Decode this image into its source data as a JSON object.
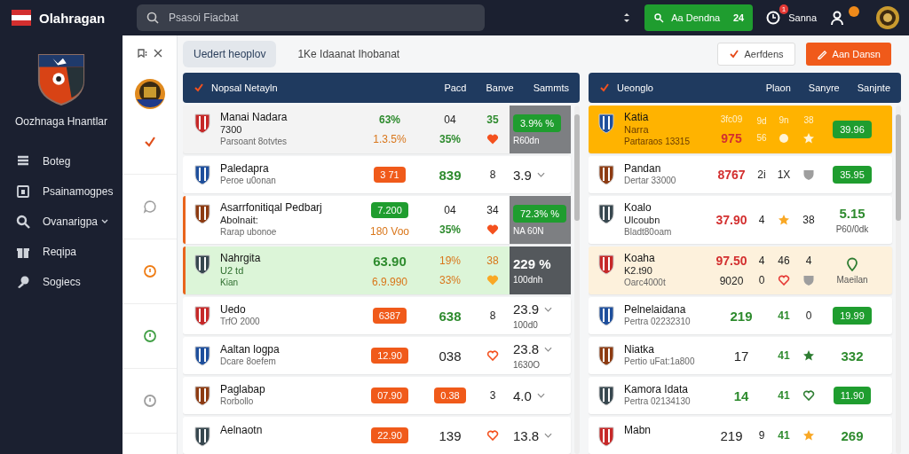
{
  "app": {
    "title": "Olahragan",
    "search_placeholder": "Psasoi Fiacbat",
    "promo_button": {
      "label": "Aa Dendna",
      "count": "24"
    },
    "notifications": "1",
    "user_label": "Sanna"
  },
  "sidebar": {
    "club_name": "Oozhnaga Hnantlar",
    "items": [
      {
        "label": "Boteg",
        "has_caret": false
      },
      {
        "label": "Psainamogpes",
        "has_caret": false
      },
      {
        "label": "Ovanarigpa",
        "has_caret": true
      },
      {
        "label": "Reqipa",
        "has_caret": false
      },
      {
        "label": "Sogiecs",
        "has_caret": false
      }
    ]
  },
  "rail": [
    {
      "kind": "check",
      "color": "#e0501c"
    },
    {
      "kind": "chat",
      "color": "#9e9e9e"
    },
    {
      "kind": "ring",
      "color": "#ef7d16"
    },
    {
      "kind": "ring",
      "color": "#43a047"
    },
    {
      "kind": "ring",
      "color": "#9e9e9e"
    }
  ],
  "toolbar": {
    "tabs": [
      {
        "label": "Uedert heoplov",
        "selected": true
      },
      {
        "label": "1Ke Idaanat Ihobanat",
        "selected": false
      }
    ],
    "buttons": [
      {
        "label": "Aerfdens",
        "kind": "outline"
      },
      {
        "label": "Aan Dansn",
        "kind": "primary"
      }
    ]
  },
  "panels": [
    {
      "title": "Nopsal Netayln",
      "columns": [
        "Pacd",
        "Banve",
        "Sammts"
      ],
      "rows": [
        {
          "name": "Manai Nadara",
          "details": [
            "7300",
            "Parsoant 8otvtes"
          ],
          "kind": "shaded",
          "accent": false,
          "cols": [
            [
              {
                "text": "63%",
                "kind": "text-green"
              },
              {
                "text": "1.3.5%",
                "kind": "text-orange"
              }
            ],
            [
              {
                "text": "04",
                "kind": "text-plain"
              },
              {
                "text": "35%",
                "kind": "text-green"
              }
            ],
            [
              {
                "text": "35",
                "kind": "text-green"
              },
              {
                "kind": "icon-heart",
                "color": "#f4511e"
              }
            ]
          ],
          "odds": {
            "kind": "boxed-pill",
            "main": "3.9% %",
            "sub": "R60dn",
            "expand": false
          }
        },
        {
          "name": "Paledapra",
          "details": [
            "Peroe u0onan"
          ],
          "kind": "plain",
          "accent": false,
          "cols": [
            [
              {
                "text": "3 71",
                "kind": "pill-orange"
              }
            ],
            [
              {
                "text": "839",
                "kind": "text-green-big"
              }
            ],
            [
              {
                "text": "8",
                "kind": "text-plain"
              }
            ]
          ],
          "odds": {
            "kind": "plain",
            "main": "3.9",
            "expand": true
          }
        },
        {
          "name": "Asarrfonitiqal Pedbarj",
          "details": [
            "Abolnait:",
            "Rarap ubonoe"
          ],
          "kind": "plain",
          "accent": true,
          "cols": [
            [
              {
                "text": "7.200",
                "kind": "pill-green"
              },
              {
                "text": "180 Voo",
                "kind": "text-orange"
              }
            ],
            [
              {
                "text": "04",
                "kind": "text-plain"
              },
              {
                "text": "35%",
                "kind": "text-green"
              }
            ],
            [
              {
                "text": "34",
                "kind": "text-plain"
              },
              {
                "kind": "icon-heart",
                "color": "#f4511e"
              }
            ]
          ],
          "odds": {
            "kind": "boxed-pill",
            "main": "72.3% %",
            "sub": "NA 60N",
            "expand": false
          }
        },
        {
          "name": "Nahrgita",
          "details": [
            "U2 td",
            "Kian"
          ],
          "kind": "live",
          "accent": true,
          "cols": [
            [
              {
                "text": "63.90",
                "kind": "text-green-big"
              },
              {
                "text": "6.9.990",
                "kind": "text-orange"
              }
            ],
            [
              {
                "text": "19%",
                "kind": "text-orange"
              },
              {
                "text": "33%",
                "kind": "text-orange"
              }
            ],
            [
              {
                "text": "38",
                "kind": "text-orange"
              },
              {
                "kind": "icon-heart",
                "color": "#f9a825"
              }
            ]
          ],
          "odds": {
            "kind": "dark-box",
            "main": "229 %",
            "sub": "100dnh",
            "expand": false
          }
        },
        {
          "name": "Uedo",
          "details": [
            "TrfO 2000"
          ],
          "kind": "plain",
          "accent": false,
          "cols": [
            [
              {
                "text": "6387",
                "kind": "pill-orange"
              }
            ],
            [
              {
                "text": "638",
                "kind": "text-green-big"
              }
            ],
            [
              {
                "text": "8",
                "kind": "text-plain"
              }
            ]
          ],
          "odds": {
            "kind": "plain",
            "main": "23.9",
            "sub": "100d0",
            "expand": true
          }
        },
        {
          "name": "Aaltan logpa",
          "details": [
            "Dcare 8oefem"
          ],
          "kind": "plain",
          "accent": false,
          "cols": [
            [
              {
                "text": "12.90",
                "kind": "pill-orange"
              }
            ],
            [
              {
                "text": "038",
                "kind": "text-big"
              }
            ],
            [
              {
                "kind": "icon-heart-outline",
                "color": "#f4511e"
              }
            ]
          ],
          "odds": {
            "kind": "plain",
            "main": "23.8",
            "sub": "1630O",
            "expand": true
          }
        },
        {
          "name": "Paglabap",
          "details": [
            "Rorbollo"
          ],
          "kind": "plain",
          "accent": false,
          "cols": [
            [
              {
                "text": "07.90",
                "kind": "pill-orange"
              }
            ],
            [
              {
                "text": "0.38",
                "kind": "pill-orange"
              }
            ],
            [
              {
                "text": "3",
                "kind": "text-plain"
              }
            ]
          ],
          "odds": {
            "kind": "plain",
            "main": "4.0",
            "expand": true
          }
        },
        {
          "name": "Aelnaotn",
          "kind": "plain",
          "accent": false,
          "cols": [
            [
              {
                "text": "22.90",
                "kind": "pill-orange"
              }
            ],
            [
              {
                "text": "139",
                "kind": "text-big"
              }
            ],
            [
              {
                "kind": "icon-heart-outline",
                "color": "#f4511e"
              }
            ]
          ],
          "odds": {
            "kind": "plain",
            "main": "13.8",
            "expand": true
          }
        }
      ]
    },
    {
      "title": "Ueonglo",
      "columns": [
        "Plaon",
        "Sanyre",
        "Sanjnte"
      ],
      "rows": [
        {
          "name": "Katia",
          "details": [
            "Narra",
            "Partaraos 13315"
          ],
          "kind": "featured",
          "accent": false,
          "cols": [
            [
              {
                "text": "3fc09",
                "kind": "text-faint"
              },
              {
                "text": "975",
                "kind": "text-red-big"
              }
            ],
            [
              {
                "text": "9d",
                "kind": "text-faint"
              },
              {
                "text": "56",
                "kind": "text-faint"
              }
            ],
            [
              {
                "text": "9n",
                "kind": "text-faint"
              },
              {
                "kind": "icon-dot",
                "color": "#fff3d6"
              }
            ],
            [
              {
                "text": "38",
                "kind": "text-faint"
              },
              {
                "kind": "icon-star",
                "color": "#fff3d6"
              }
            ]
          ],
          "odds": {
            "kind": "pill",
            "main": "39.96",
            "expand": false
          }
        },
        {
          "name": "Pandan",
          "details": [
            "Dertar 33000"
          ],
          "kind": "plain",
          "accent": false,
          "cols": [
            [
              {
                "text": "8767",
                "kind": "text-red-big"
              }
            ],
            [
              {
                "text": "2i",
                "kind": "text-plain"
              }
            ],
            [
              {
                "text": "1X",
                "kind": "text-plain"
              }
            ],
            [
              {
                "kind": "icon-shield",
                "color": "#9e9e9e"
              }
            ]
          ],
          "odds": {
            "kind": "pill",
            "main": "35.95",
            "expand": false
          }
        },
        {
          "name": "Koalo",
          "details": [
            "Ulcoubn",
            "Bladt80oam"
          ],
          "kind": "plain",
          "accent": false,
          "cols": [
            [
              {
                "text": "37.90",
                "kind": "text-red-big"
              }
            ],
            [
              {
                "text": "4",
                "kind": "text-plain"
              }
            ],
            [
              {
                "kind": "icon-star",
                "color": "#f9a825"
              }
            ],
            [
              {
                "text": "38",
                "kind": "text-plain"
              }
            ]
          ],
          "odds": {
            "kind": "green",
            "main": "5.15",
            "sub": "P60/0dk",
            "expand": false
          }
        },
        {
          "name": "Koaha",
          "details": [
            "K2.t90",
            "Oarc4000t"
          ],
          "kind": "pending",
          "accent": false,
          "cols": [
            [
              {
                "text": "97.50",
                "kind": "text-red-big"
              },
              {
                "text": "9020",
                "kind": "text-plain"
              }
            ],
            [
              {
                "text": "4",
                "kind": "text-plain"
              },
              {
                "text": "0",
                "kind": "text-plain"
              }
            ],
            [
              {
                "text": "46",
                "kind": "text-plain"
              },
              {
                "kind": "icon-heart-outline",
                "color": "#e53935"
              }
            ],
            [
              {
                "text": "4",
                "kind": "text-plain"
              },
              {
                "kind": "icon-shield",
                "color": "#9e9e9e"
              }
            ]
          ],
          "odds": {
            "kind": "pin",
            "sub": "Maeilan",
            "expand": false
          }
        },
        {
          "name": "Pelnelaidana",
          "details": [
            "Pertra 02232310"
          ],
          "kind": "plain",
          "accent": false,
          "cols": [
            [
              {
                "text": "219",
                "kind": "text-green-big"
              }
            ],
            [
              {
                "text": "41",
                "kind": "text-green"
              }
            ],
            [
              {
                "text": "0",
                "kind": "text-plain"
              }
            ]
          ],
          "odds": {
            "kind": "pill",
            "main": "19.99",
            "expand": false
          }
        },
        {
          "name": "Niatka",
          "details": [
            "Pertio uFat:1a800"
          ],
          "kind": "plain",
          "accent": false,
          "cols": [
            [
              {
                "text": "17",
                "kind": "text-big"
              }
            ],
            [
              {
                "text": "41",
                "kind": "text-green"
              }
            ],
            [
              {
                "kind": "icon-star",
                "color": "#2e7d32"
              }
            ]
          ],
          "odds": {
            "kind": "green",
            "main": "332",
            "expand": false
          }
        },
        {
          "name": "Kamora Idata",
          "details": [
            "Pertra 02134130"
          ],
          "kind": "plain",
          "accent": false,
          "cols": [
            [
              {
                "text": "14",
                "kind": "text-green-big"
              }
            ],
            [
              {
                "text": "41",
                "kind": "text-green"
              }
            ],
            [
              {
                "kind": "icon-heart-outline",
                "color": "#2e7d32"
              }
            ]
          ],
          "odds": {
            "kind": "pill",
            "main": "11.90",
            "expand": false
          }
        },
        {
          "name": "Mabn",
          "kind": "plain",
          "accent": false,
          "cols": [
            [
              {
                "text": "219",
                "kind": "text-big"
              }
            ],
            [
              {
                "text": "9",
                "kind": "text-plain"
              }
            ],
            [
              {
                "text": "41",
                "kind": "text-green"
              }
            ],
            [
              {
                "kind": "icon-star",
                "color": "#f9a825"
              }
            ]
          ],
          "odds": {
            "kind": "green",
            "main": "269",
            "expand": false
          }
        }
      ]
    }
  ]
}
